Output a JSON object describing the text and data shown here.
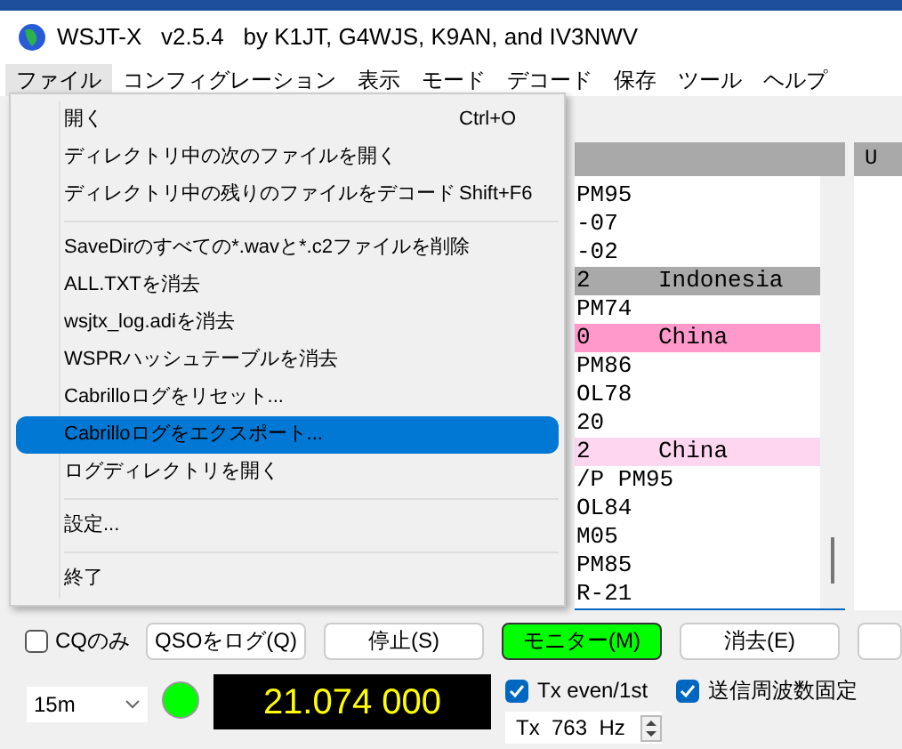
{
  "window": {
    "title": "WSJT-X   v2.5.4   by K1JT, G4WJS, K9AN, and IV3NWV"
  },
  "menubar": [
    {
      "label": "ファイル",
      "selected": true
    },
    {
      "label": "コンフィグレーション",
      "selected": false
    },
    {
      "label": "表示",
      "selected": false
    },
    {
      "label": "モード",
      "selected": false
    },
    {
      "label": "デコード",
      "selected": false
    },
    {
      "label": "保存",
      "selected": false
    },
    {
      "label": "ツール",
      "selected": false
    },
    {
      "label": "ヘルプ",
      "selected": false
    }
  ],
  "file_menu": [
    {
      "kind": "item",
      "label": "開く",
      "shortcut": "Ctrl+O",
      "selected": false
    },
    {
      "kind": "item",
      "label": "ディレクトリ中の次のファイルを開く",
      "selected": false
    },
    {
      "kind": "item",
      "label": "ディレクトリ中の残りのファイルをデコード",
      "shortcut": "Shift+F6",
      "selected": false
    },
    {
      "kind": "separator"
    },
    {
      "kind": "item",
      "label": "SaveDirのすべての*.wavと*.c2ファイルを削除",
      "selected": false
    },
    {
      "kind": "item",
      "label": "ALL.TXTを消去",
      "selected": false
    },
    {
      "kind": "item",
      "label": "wsjtx_log.adiを消去",
      "selected": false
    },
    {
      "kind": "item",
      "label": "WSPRハッシュテーブルを消去",
      "selected": false
    },
    {
      "kind": "item",
      "label": "Cabrilloログをリセット...",
      "selected": false
    },
    {
      "kind": "item",
      "label": "Cabrilloログをエクスポート...",
      "selected": true
    },
    {
      "kind": "item",
      "label": "ログディレクトリを開く",
      "selected": false
    },
    {
      "kind": "separator"
    },
    {
      "kind": "item",
      "label": "設定...",
      "selected": false
    },
    {
      "kind": "separator"
    },
    {
      "kind": "item",
      "label": "終了",
      "selected": false
    }
  ],
  "decode_pane": {
    "rows": [
      {
        "text": "PM95"
      },
      {
        "text": "-07"
      },
      {
        "text": "-02"
      },
      {
        "text": "2",
        "country": "Indonesia",
        "color": "#a9a9a9"
      },
      {
        "text": "PM74"
      },
      {
        "text": "0",
        "country": "China",
        "color": "#ff99cc"
      },
      {
        "text": "PM86"
      },
      {
        "text": "OL78"
      },
      {
        "text": "20"
      },
      {
        "text": "2",
        "country": "China",
        "color": "#ffd6f0"
      },
      {
        "text": "/P PM95"
      },
      {
        "text": "OL84"
      },
      {
        "text": "M05"
      },
      {
        "text": "PM85"
      },
      {
        "text": "R-21"
      }
    ]
  },
  "right_pane": {
    "header": "U"
  },
  "controls": {
    "cq_only": {
      "label": "CQのみ",
      "checked": false
    },
    "buttons": [
      {
        "label": "QSOをログ(Q)",
        "on": false
      },
      {
        "label": "停止(S)",
        "on": false
      },
      {
        "label": "モニター(M)",
        "on": true
      },
      {
        "label": "消去(E)",
        "on": false
      },
      {
        "on": false
      }
    ],
    "band": "15m",
    "frequency": "21.074 000",
    "tx_even": {
      "label": "Tx even/1st",
      "checked": true
    },
    "hold_tx": {
      "label": "送信周波数固定",
      "checked": true
    },
    "tx_freq": {
      "prefix": "Tx",
      "value": "763",
      "unit": "Hz"
    }
  }
}
